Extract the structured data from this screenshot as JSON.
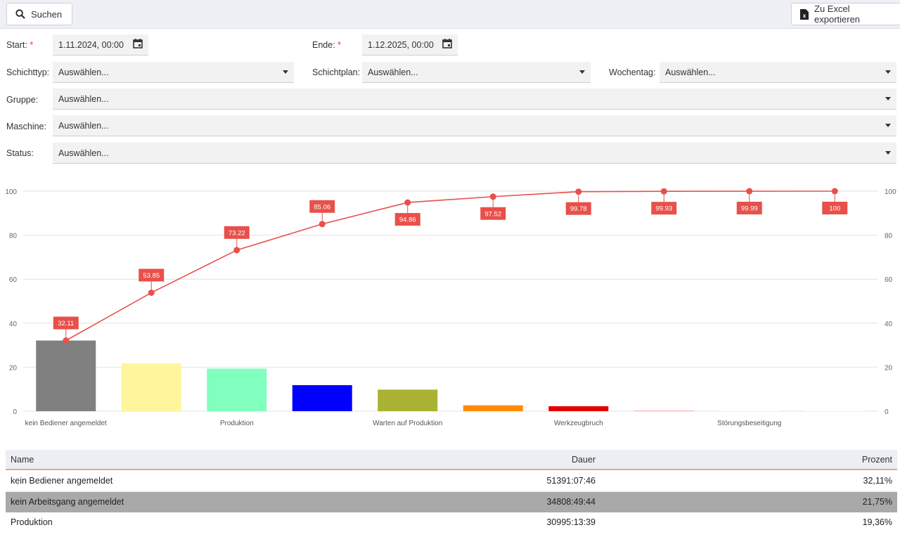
{
  "toolbar": {
    "search_label": "Suchen",
    "export_label": "Zu Excel exportieren"
  },
  "filters": {
    "start_label": "Start:",
    "start_value": "1.11.2024, 00:00",
    "end_label": "Ende:",
    "end_value": "1.12.2025, 00:00",
    "required_mark": "*",
    "schichttyp_label": "Schichttyp:",
    "schichttyp_value": "Auswählen...",
    "schichtplan_label": "Schichtplan:",
    "schichtplan_value": "Auswählen...",
    "wochentag_label": "Wochentag:",
    "wochentag_value": "Auswählen...",
    "gruppe_label": "Gruppe:",
    "gruppe_value": "Auswählen...",
    "maschine_label": "Maschine:",
    "maschine_value": "Auswählen...",
    "status_label": "Status:",
    "status_value": "Auswählen..."
  },
  "chart_data": {
    "type": "bar",
    "categories": [
      "kein Bediener angemeldet",
      "kein Arbeitsgang angemeldet",
      "Produktion",
      "",
      "Warten auf Produktion",
      "",
      "Werkzeugbruch",
      "",
      "Störungsbeseitigung",
      ""
    ],
    "x_tick_labels": [
      "kein Bediener angemeldet",
      "Produktion",
      "Warten auf Produktion",
      "Werkzeugbruch",
      "Störungsbeseitigung"
    ],
    "series": [
      {
        "type": "bar",
        "values": [
          32.11,
          21.75,
          19.36,
          11.84,
          9.8,
          2.66,
          2.26,
          0.15,
          0.06,
          0.01
        ],
        "colors": [
          "#808080",
          "#fff59d",
          "#80ffbf",
          "#0000ff",
          "#a9b232",
          "#ff8c00",
          "#e50000",
          "#f08080",
          "#ffffff",
          "#ffffff"
        ]
      },
      {
        "type": "line",
        "values": [
          32.11,
          53.85,
          73.22,
          85.06,
          94.86,
          97.52,
          99.78,
          99.93,
          99.99,
          100
        ],
        "labels": [
          "32.11",
          "53.85",
          "73.22",
          "85.06",
          "94.86",
          "97.52",
          "99.78",
          "99.93",
          "99.99",
          "100"
        ],
        "color": "#e8504a"
      }
    ],
    "ylim": [
      0,
      100
    ],
    "yticks": [
      0,
      20,
      40,
      60,
      80,
      100
    ],
    "grid": true,
    "legend": "none"
  },
  "table": {
    "headers": {
      "name": "Name",
      "dauer": "Dauer",
      "prozent": "Prozent"
    },
    "rows": [
      {
        "name": "kein Bediener angemeldet",
        "dauer": "51391:07:46",
        "prozent": "32,11%"
      },
      {
        "name": "kein Arbeitsgang angemeldet",
        "dauer": "34808:49:44",
        "prozent": "21,75%"
      },
      {
        "name": "Produktion",
        "dauer": "30995:13:39",
        "prozent": "19,36%"
      }
    ]
  },
  "colors": {
    "accent_line": "#e8504a",
    "selected_row": "#a9a9a9",
    "header_underline": "#f0a57a"
  }
}
